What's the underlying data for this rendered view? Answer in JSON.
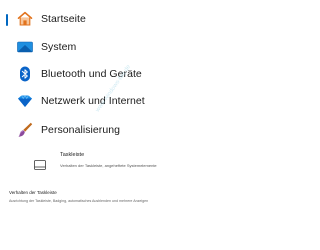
{
  "nav": {
    "items": [
      {
        "label": "Startseite",
        "icon": "home-icon",
        "selected": true
      },
      {
        "label": "System",
        "icon": "system-display-icon",
        "selected": false
      },
      {
        "label": "Bluetooth und Geräte",
        "icon": "bluetooth-icon",
        "selected": false
      },
      {
        "label": "Netzwerk und Internet",
        "icon": "network-diamond-icon",
        "selected": false
      },
      {
        "label": "Personalisierung",
        "icon": "paint-brush-icon",
        "selected": false
      }
    ]
  },
  "taskbar_item": {
    "title": "Taskleiste",
    "description": "Verhalten der Taskleiste, angeheftete Systemelemente",
    "icon": "taskbar-icon"
  },
  "behavior": {
    "title": "Verhalten der Taskleiste",
    "description": "Ausrichtung der Taskleiste, Badging, automatisches Ausblenden und mehrere Anzeigen"
  },
  "watermark": {
    "text": "www.windows-faq.de"
  },
  "colors": {
    "accent": "#0067c0",
    "background": "#ffffff",
    "text": "#1b1b1b"
  }
}
